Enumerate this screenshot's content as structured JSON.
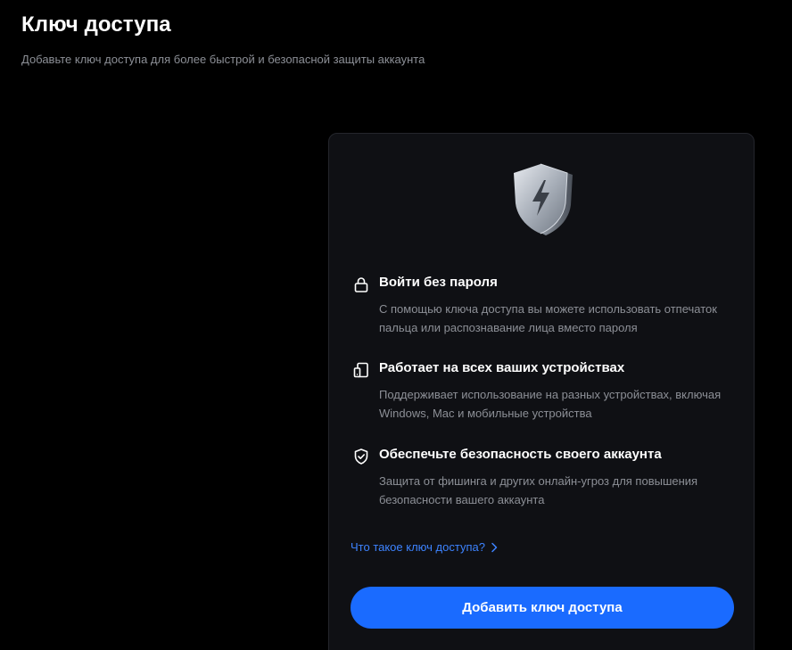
{
  "header": {
    "title": "Ключ доступа",
    "subtitle": "Добавьте ключ доступа для более быстрой и безопасной защиты аккаунта"
  },
  "card": {
    "illustration_icon": "shield-lightning-icon",
    "features": [
      {
        "icon": "lock-icon",
        "title": "Войти без пароля",
        "description": "С помощью ключа доступа вы можете использовать отпечаток пальца или распознавание лица вместо пароля"
      },
      {
        "icon": "devices-icon",
        "title": "Работает на всех ваших устройствах",
        "description": "Поддерживает использование на разных устройствах, включая Windows, Mac и мобильные устройства"
      },
      {
        "icon": "shield-check-icon",
        "title": "Обеспечьте безопасность своего аккаунта",
        "description": "Защита от фишинга и других онлайн-угроз для повышения безопасности вашего аккаунта"
      }
    ],
    "info_link": "Что такое ключ доступа?",
    "add_button": "Добавить ключ доступа"
  },
  "colors": {
    "background": "#000000",
    "card": "#0f1014",
    "accent": "#1a6bff",
    "link": "#3d83ff",
    "muted_text": "#8c8f96"
  }
}
